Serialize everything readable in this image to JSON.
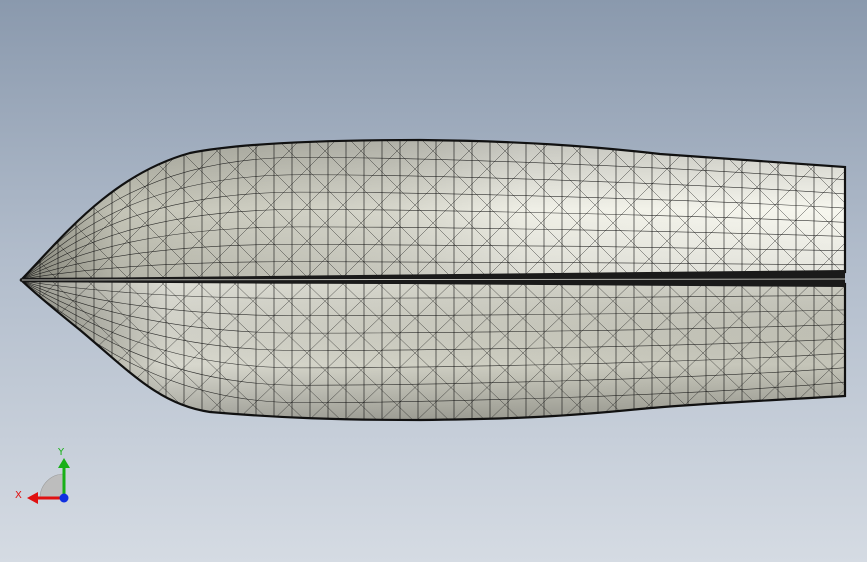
{
  "viewport": {
    "background_top": "#8a99ad",
    "background_bottom": "#d5dbe3",
    "model": "hull-wireframe"
  },
  "hull": {
    "fill_light": "#f4f4ec",
    "fill_mid": "#d0d0c4",
    "fill_dark": "#9d9d90",
    "edge_color": "#111111"
  },
  "triad": {
    "x_label": "X",
    "y_label": "Y",
    "x_color": "#e01010",
    "y_color": "#18b018",
    "z_color": "#1030e0"
  }
}
